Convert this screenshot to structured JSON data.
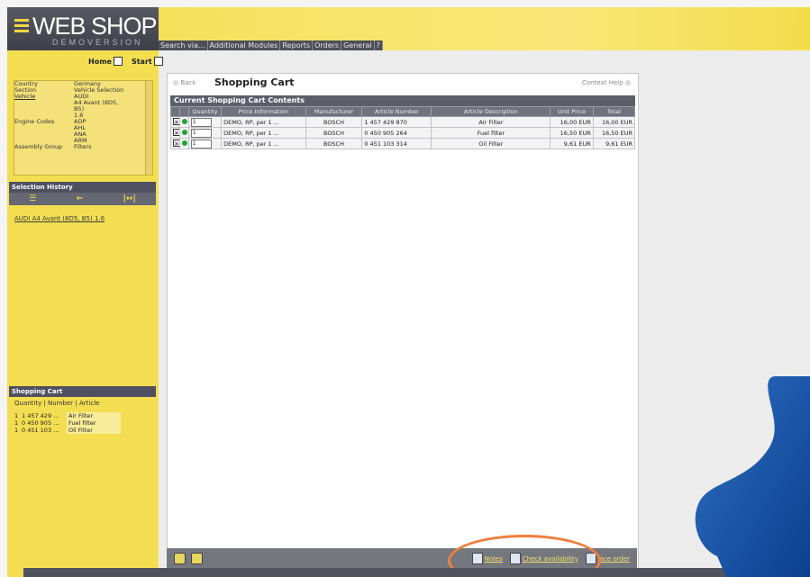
{
  "app": {
    "logo": "WEB SHOP",
    "subtitle": "DEMOVERSION"
  },
  "nav": [
    "Search via...",
    "Additional Modules",
    "Reports",
    "Orders",
    "General",
    "?"
  ],
  "left": {
    "home": "Home",
    "start": "Start",
    "vehicle": [
      {
        "k": "Country",
        "v": "Germany"
      },
      {
        "k": "Section",
        "v": "Vehicle Selection"
      },
      {
        "k": "Vehicle",
        "v": "AUDI"
      },
      {
        "k": "",
        "v": "A4 Avant (8D5,"
      },
      {
        "k": "",
        "v": "B5)"
      },
      {
        "k": "",
        "v": "1.6"
      },
      {
        "k": "Engine Codes",
        "v": "ADP"
      },
      {
        "k": "",
        "v": "AHL"
      },
      {
        "k": "",
        "v": "ANA"
      },
      {
        "k": "",
        "v": "ARM"
      },
      {
        "k": "Assembly Group",
        "v": "Filters"
      }
    ],
    "history_title": "Selection History",
    "history_link": "AUDI A4 Avant (8D5, B5) 1.6",
    "cart_title": "Shopping Cart",
    "cart_columns": "Quantity | Number | Article",
    "cart_items": [
      {
        "q": "1",
        "n": "1 457 429 ...",
        "a": "Air Filter"
      },
      {
        "q": "1",
        "n": "0 450 905 ...",
        "a": "Fuel filter"
      },
      {
        "q": "1",
        "n": "0 451 103 ...",
        "a": "Oil Filter"
      }
    ]
  },
  "main": {
    "back": "Back",
    "title": "Shopping Cart",
    "context_help": "Context Help",
    "table_title": "Current Shopping Cart Contents",
    "columns": [
      "",
      "",
      "Quantity",
      "Price Information",
      "Manufacturer",
      "Article Number",
      "Article Description",
      "Unit Price",
      "Total"
    ],
    "rows": [
      {
        "qty": "1",
        "price": "DEMO, RP, per 1 ...",
        "mfr": "BOSCH",
        "num": "1 457 429 870",
        "desc": "Air Filter",
        "unit": "16,00 EUR",
        "total": "16,00 EUR"
      },
      {
        "qty": "1",
        "price": "DEMO, RP, per 1 ...",
        "mfr": "BOSCH",
        "num": "0 450 905 264",
        "desc": "Fuel filter",
        "unit": "16,50 EUR",
        "total": "16,50 EUR"
      },
      {
        "qty": "1",
        "price": "DEMO, RP, per 1 ...",
        "mfr": "BOSCH",
        "num": "0 451 103 314",
        "desc": "Oil Filter",
        "unit": "9,61 EUR",
        "total": "9,61 EUR"
      }
    ]
  },
  "bottom": {
    "notes": "Notes",
    "check": "Check availability",
    "place": "lace order"
  }
}
